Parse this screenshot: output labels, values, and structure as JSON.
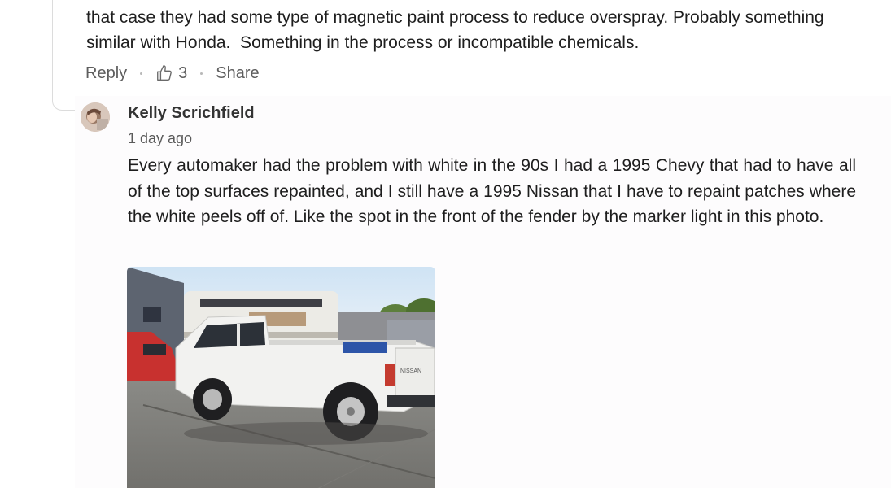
{
  "parent_comment": {
    "text_line1": "that case they had some type of magnetic paint process to reduce overspray. Probably something",
    "text_line2": "similar with Honda.  Something in the process or incompatible chemicals.",
    "actions": {
      "reply_label": "Reply",
      "like_count": "3",
      "share_label": "Share"
    }
  },
  "reply_comment": {
    "author": "Kelly Scrichfield",
    "timestamp": "1 day ago",
    "text": "Every automaker had the problem with white in the 90s I had a 1995 Chevy that had to have all of the top surfaces repainted, and I still have a 1995 Nissan that I have to repaint patches where the white peels off of. Like the spot in the front of the fender by the marker light in this photo.",
    "photo_badge_text": "NISSAN"
  },
  "colors": {
    "text": "#1e1e1e",
    "muted": "#5e5e5e",
    "thread_line": "#dcdcdc"
  }
}
